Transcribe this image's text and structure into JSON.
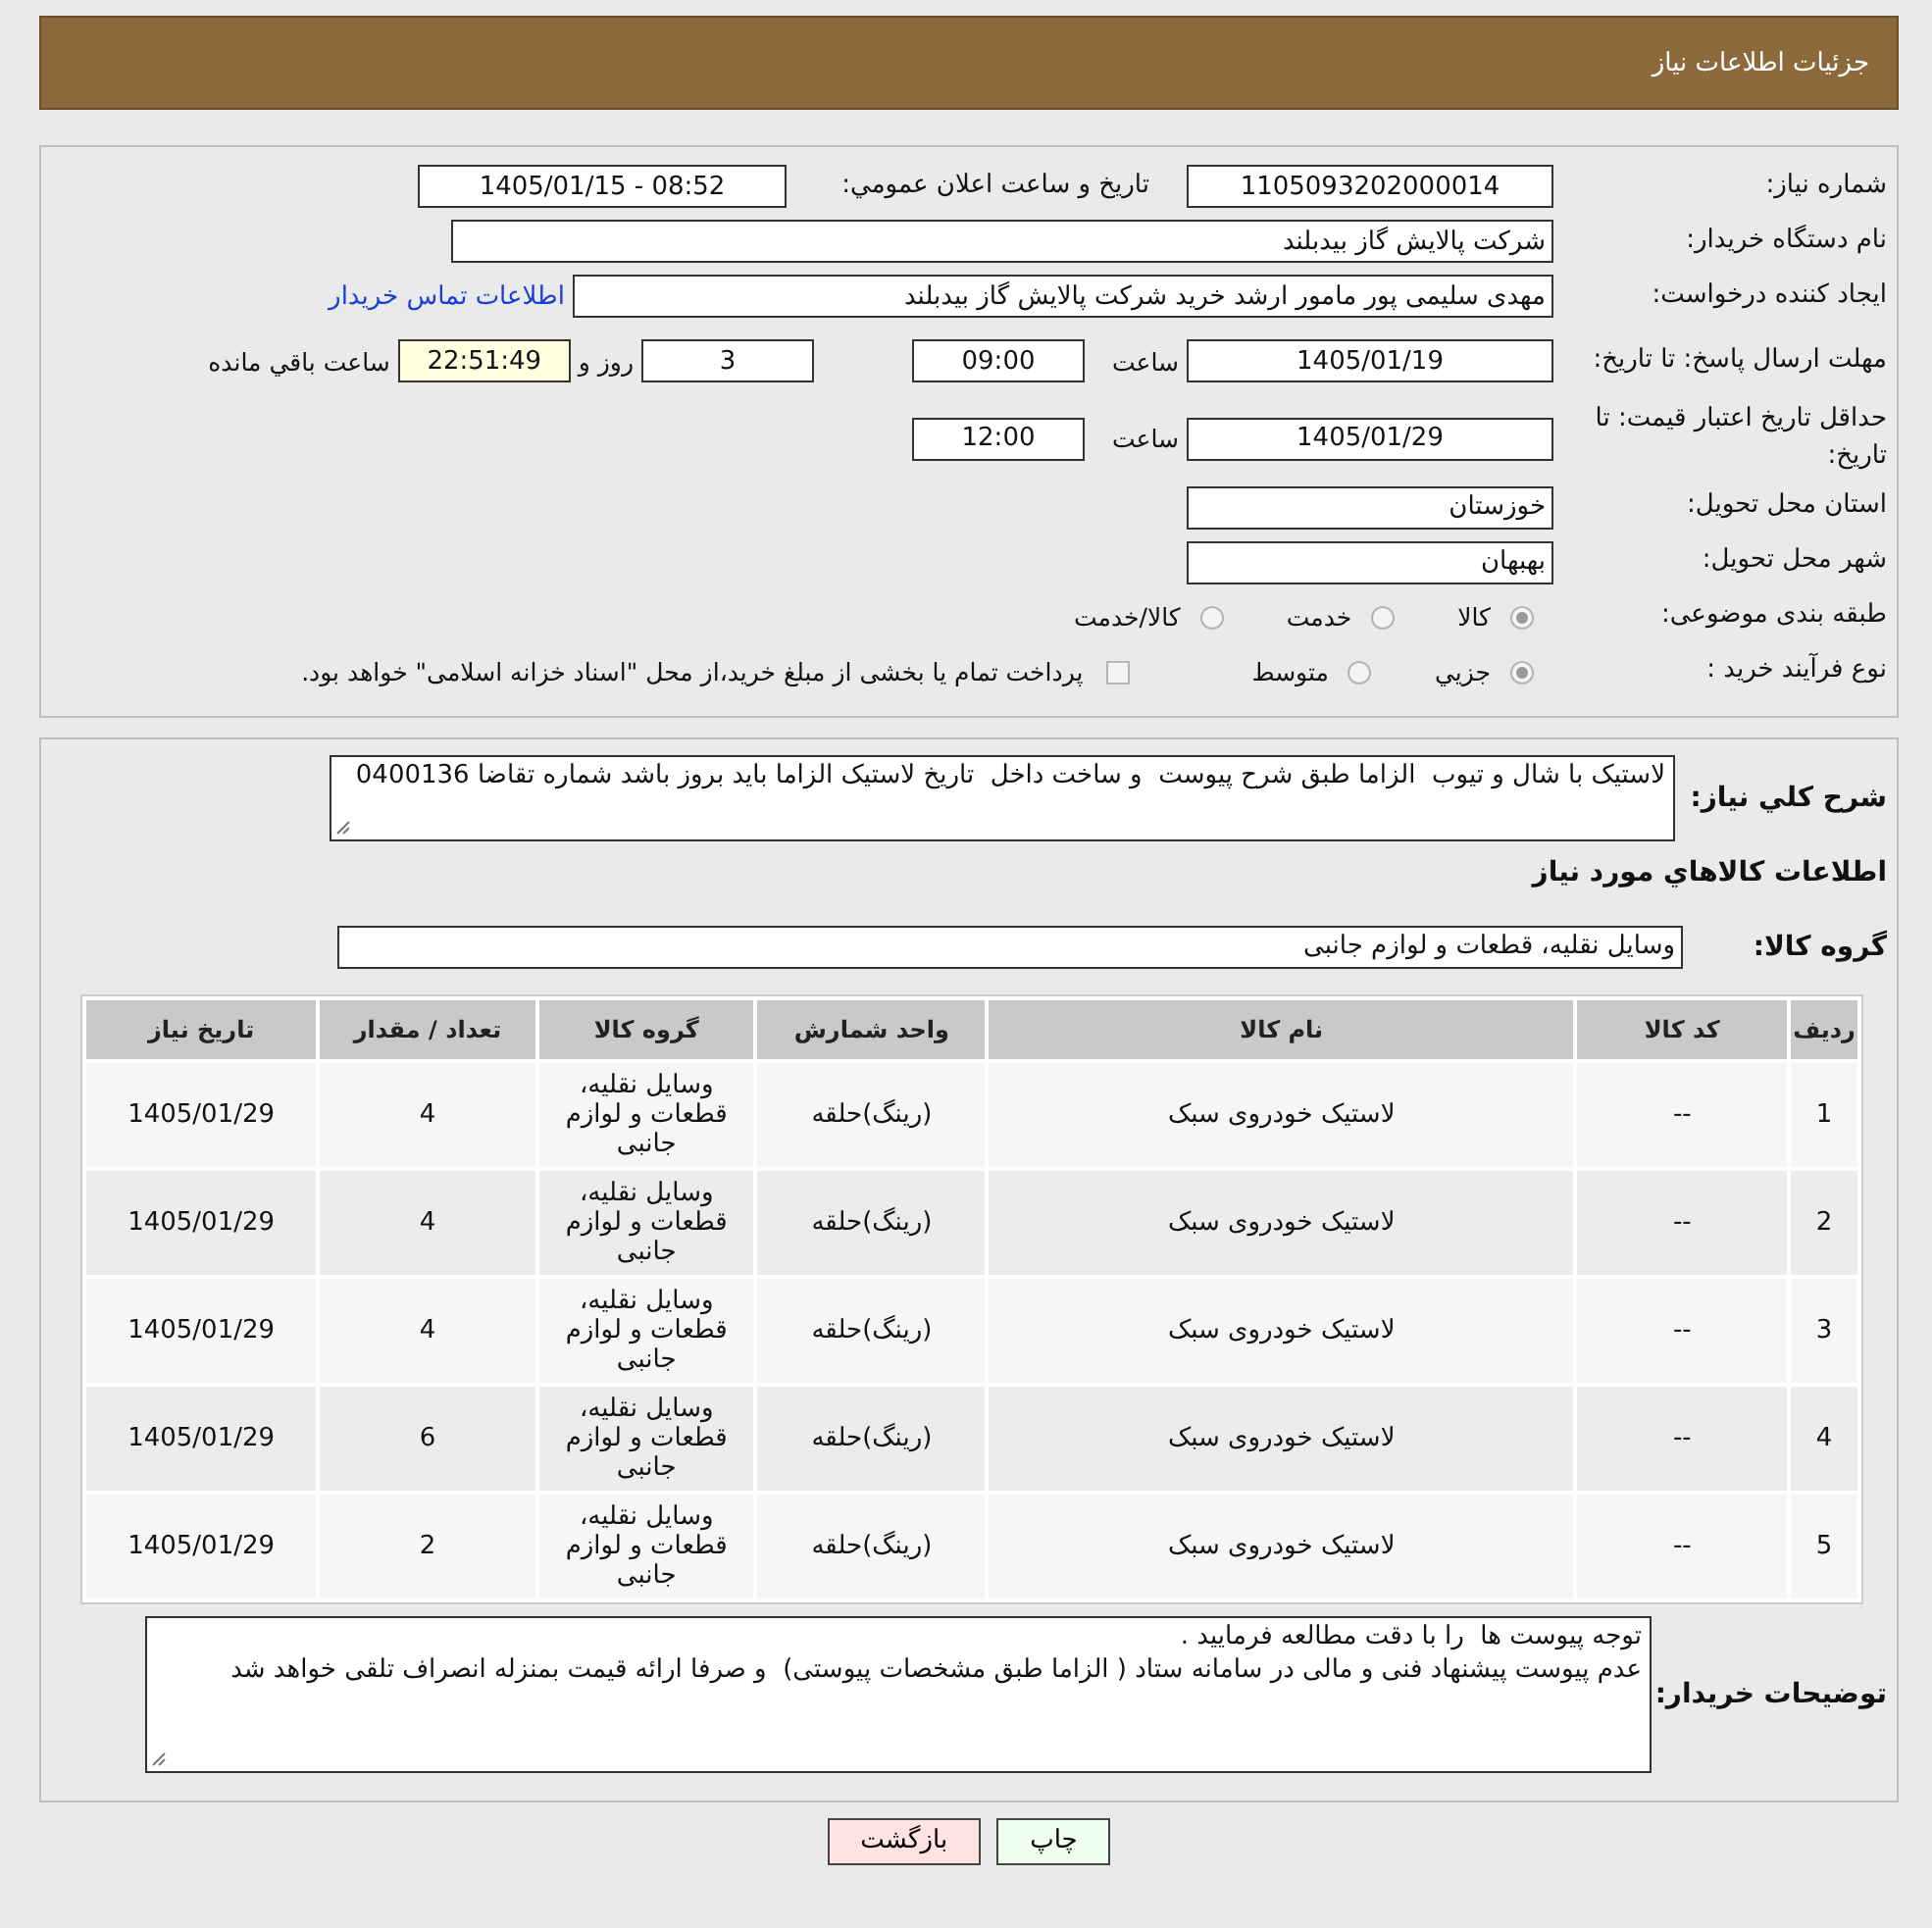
{
  "header": {
    "title": "جزئیات اطلاعات نیاز"
  },
  "need_number": {
    "label": "شماره نیاز:",
    "value": "1105093202000014"
  },
  "announce": {
    "label": "تاریخ و ساعت اعلان عمومي:",
    "value": "1405/01/15 - 08:52"
  },
  "buyer_org": {
    "label": "نام دستگاه خریدار:",
    "value": "شرکت پالایش گاز بیدبلند"
  },
  "requester": {
    "label": "ایجاد کننده درخواست:",
    "value": "مهدی سلیمی پور مامور ارشد خرید شرکت پالایش گاز بیدبلند",
    "contact_link": "اطلاعات تماس خریدار"
  },
  "reply_deadline": {
    "label": "مهلت ارسال پاسخ: تا تاریخ:",
    "date": "1405/01/19",
    "time_label": "ساعت",
    "time": "09:00",
    "days": "3",
    "days_label": "روز و",
    "remaining": "22:51:49",
    "remaining_label": "ساعت باقي مانده"
  },
  "price_validity": {
    "label": "حداقل تاریخ اعتبار قیمت: تا تاریخ:",
    "date": "1405/01/29",
    "time_label": "ساعت",
    "time": "12:00"
  },
  "province": {
    "label": "استان محل تحویل:",
    "value": "خوزستان"
  },
  "city": {
    "label": "شهر محل تحویل:",
    "value": "بهبهان"
  },
  "category": {
    "label": "طبقه بندی موضوعی:",
    "options": [
      {
        "label": "کالا",
        "selected": true
      },
      {
        "label": "خدمت",
        "selected": false
      },
      {
        "label": "کالا/خدمت",
        "selected": false
      }
    ]
  },
  "process": {
    "label": "نوع فرآیند خرید :",
    "options": [
      {
        "label": "جزيي",
        "selected": true
      },
      {
        "label": "متوسط",
        "selected": false
      }
    ],
    "payment": {
      "label": "پرداخت تمام یا بخشی از مبلغ خرید،از محل \"اسناد خزانه اسلامی\" خواهد بود.",
      "checked": false
    }
  },
  "description": {
    "label": "شرح کلي نیاز:",
    "value": "لاستیک با شال و تیوب  الزاما طبق شرح پیوست  و ساخت داخل  تاریخ لاستیک الزاما باید بروز باشد شماره تقاضا 0400136"
  },
  "goods_heading": "اطلاعات کالاهاي مورد نیاز",
  "goods_group": {
    "label": "گروه کالا:",
    "value": "وسایل نقلیه، قطعات و لوازم جانبی"
  },
  "table": {
    "columns": [
      "ردیف",
      "کد کالا",
      "نام کالا",
      "واحد شمارش",
      "گروه کالا",
      "تعداد / مقدار",
      "تاریخ نیاز"
    ],
    "rows": [
      [
        "1",
        "--",
        "لاستیک خودروی سبک",
        "(رینگ)حلقه",
        "وسایل نقلیه، قطعات و لوازم جانبی",
        "4",
        "1405/01/29"
      ],
      [
        "2",
        "--",
        "لاستیک خودروی سبک",
        "(رینگ)حلقه",
        "وسایل نقلیه، قطعات و لوازم جانبی",
        "4",
        "1405/01/29"
      ],
      [
        "3",
        "--",
        "لاستیک خودروی سبک",
        "(رینگ)حلقه",
        "وسایل نقلیه، قطعات و لوازم جانبی",
        "4",
        "1405/01/29"
      ],
      [
        "4",
        "--",
        "لاستیک خودروی سبک",
        "(رینگ)حلقه",
        "وسایل نقلیه، قطعات و لوازم جانبی",
        "6",
        "1405/01/29"
      ],
      [
        "5",
        "--",
        "لاستیک خودروی سبک",
        "(رینگ)حلقه",
        "وسایل نقلیه، قطعات و لوازم جانبی",
        "2",
        "1405/01/29"
      ]
    ]
  },
  "buyer_notes": {
    "label": "توضیحات خریدار:",
    "value": "توجه پیوست ها  را با دقت مطالعه فرمایید .\nعدم پیوست پیشنهاد فنی و مالی در سامانه ستاد ( الزاما طبق مشخصات پیوستی)  و صرفا ارائه قیمت بمنزله انصراف تلقی خواهد شد"
  },
  "buttons": [
    {
      "label": "چاپ",
      "kind": "print"
    },
    {
      "label": "بازگشت",
      "kind": "back"
    }
  ]
}
